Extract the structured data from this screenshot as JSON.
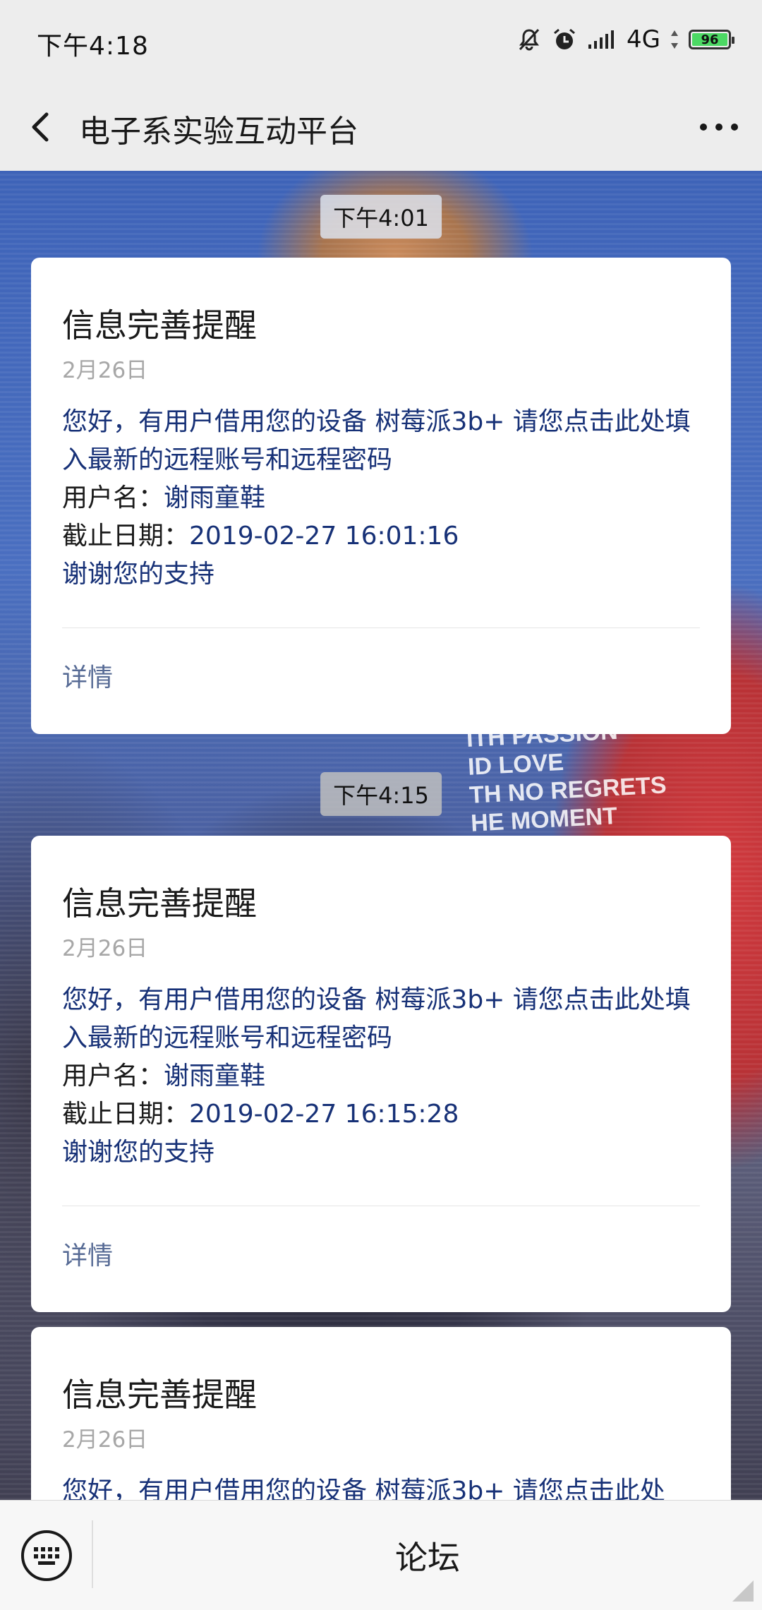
{
  "status": {
    "time": "下午4:18",
    "network": "4G",
    "battery": "96"
  },
  "nav": {
    "title": "电子系实验互动平台"
  },
  "messages": [
    {
      "time": "下午4:01",
      "title": "信息完善提醒",
      "date": "2月26日",
      "body": "您好，有用户借用您的设备 树莓派3b+ 请您点击此处填入最新的远程账号和远程密码",
      "user_label": "用户名：",
      "user_value": "谢雨童鞋",
      "deadline_label": "截止日期：",
      "deadline_value": "2019-02-27 16:01:16",
      "thanks": "谢谢您的支持",
      "detail": "详情"
    },
    {
      "time": "下午4:15",
      "title": "信息完善提醒",
      "date": "2月26日",
      "body": "您好，有用户借用您的设备 树莓派3b+ 请您点击此处填入最新的远程账号和远程密码",
      "user_label": "用户名：",
      "user_value": "谢雨童鞋",
      "deadline_label": "截止日期：",
      "deadline_value": "2019-02-27 16:15:28",
      "thanks": "谢谢您的支持",
      "detail": "详情"
    },
    {
      "title": "信息完善提醒",
      "date": "2月26日",
      "body": "您好，有用户借用您的设备 树莓派3b+ 请您点击此处"
    }
  ],
  "background_text": [
    "ITH PASSION",
    "ID LOVE",
    "TH NO REGRETS",
    "HE MOMENT"
  ],
  "bottom": {
    "menu_label": "论坛"
  },
  "colors": {
    "link_blue": "#576b95",
    "body_blue": "#173177",
    "battery_green": "#4cd964"
  }
}
